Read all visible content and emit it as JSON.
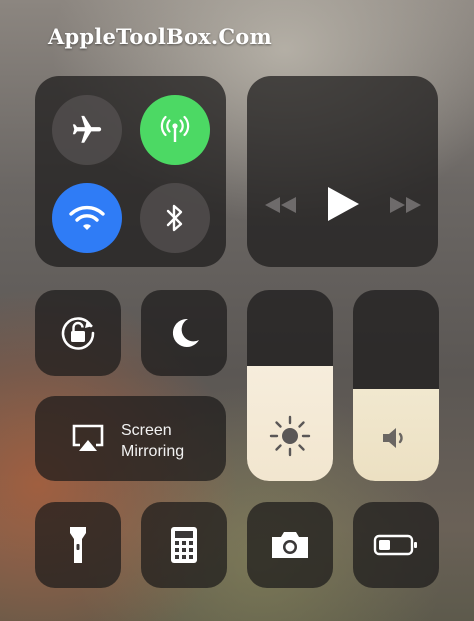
{
  "watermark": "AppleToolBox.Com",
  "connectivity": {
    "airplane": {
      "icon": "airplane-icon",
      "active": false
    },
    "cellular": {
      "icon": "cellular-antenna-icon",
      "active": true,
      "color": "#4cd964"
    },
    "wifi": {
      "icon": "wifi-icon",
      "active": true,
      "color": "#2f7cf6"
    },
    "bluetooth": {
      "icon": "bluetooth-icon",
      "active": false
    }
  },
  "media": {
    "rewind_icon": "rewind-icon",
    "play_icon": "play-icon",
    "forward_icon": "fast-forward-icon"
  },
  "controls": {
    "orientation_lock": {
      "icon": "rotation-lock-icon"
    },
    "do_not_disturb": {
      "icon": "moon-icon"
    }
  },
  "screen_mirroring": {
    "icon": "airplay-icon",
    "label_line1": "Screen",
    "label_line2": "Mirroring"
  },
  "brightness": {
    "icon": "sun-icon",
    "level": 0.6
  },
  "volume": {
    "icon": "speaker-icon",
    "level": 0.48
  },
  "bottom_row": [
    {
      "name": "flashlight",
      "icon": "flashlight-icon"
    },
    {
      "name": "calculator",
      "icon": "calculator-icon"
    },
    {
      "name": "camera",
      "icon": "camera-icon"
    },
    {
      "name": "low-power-mode",
      "icon": "battery-icon"
    }
  ]
}
